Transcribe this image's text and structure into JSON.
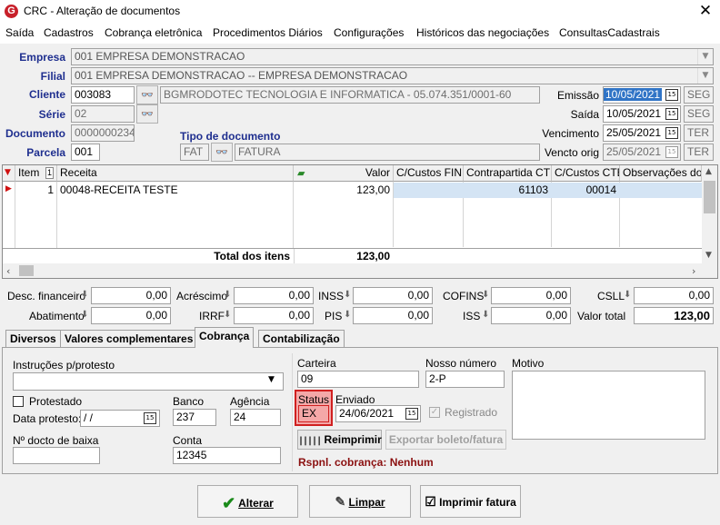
{
  "window": {
    "title": "CRC - Alteração de documentos",
    "app_icon": "G",
    "close": "✕"
  },
  "menu": [
    "Saída",
    "Cadastros",
    "Cobrança eletrônica",
    "Procedimentos Diários",
    "Configurações",
    "Históricos das negociações",
    "ConsultasCadastrais"
  ],
  "header": {
    "empresa_label": "Empresa",
    "empresa_value": "001 EMPRESA DEMONSTRACAO",
    "filial_label": "Filial",
    "filial_value": "001 EMPRESA DEMONSTRACAO -- EMPRESA DEMONSTRACAO",
    "cliente_label": "Cliente",
    "cliente_code": "003083",
    "cliente_name": "BGMRODOTEC TECNOLOGIA  E INFORMATICA - 05.074.351/0001-60",
    "serie_label": "Série",
    "serie_value": "02",
    "documento_label": "Documento",
    "documento_value": "0000000234",
    "parcela_label": "Parcela",
    "parcela_value": "001",
    "tipo_doc_label": "Tipo de documento",
    "tipo_doc_code": "FAT",
    "tipo_doc_name": "FATURA",
    "emissao_label": "Emissão",
    "emissao_value": "10/05/2021",
    "emissao_day": "SEG",
    "saida_label": "Saída",
    "saida_value": "10/05/2021",
    "saida_day": "SEG",
    "vencimento_label": "Vencimento",
    "vencimento_value": "25/05/2021",
    "vencimento_day": "TER",
    "vencto_orig_label": "Vencto orig",
    "vencto_orig_value": "25/05/2021",
    "vencto_orig_day": "TER"
  },
  "items_grid": {
    "columns": [
      "Item",
      "1",
      "Receita",
      "Valor",
      "C/Custos FIN",
      "Contrapartida CTB",
      "C/Custos CTB",
      "Observações do ite"
    ],
    "rows": [
      {
        "item": "1",
        "receita": "00048-RECEITA TESTE",
        "valor": "123,00",
        "cc_fin": "",
        "contrapartida": "61103",
        "cc_ctb": "00014",
        "obs": ""
      }
    ],
    "total_label": "Total dos itens",
    "total_value": "123,00"
  },
  "totals": {
    "desc_financeiro_label": "Desc. financeiro",
    "desc_financeiro": "0,00",
    "acrescimo_label": "Acréscimo",
    "acrescimo": "0,00",
    "inss_label": "INSS",
    "inss": "0,00",
    "cofins_label": "COFINS",
    "cofins": "0,00",
    "csll_label": "CSLL",
    "csll": "0,00",
    "abatimento_label": "Abatimento",
    "abatimento": "0,00",
    "irrf_label": "IRRF",
    "irrf": "0,00",
    "pis_label": "PIS",
    "pis": "0,00",
    "iss_label": "ISS",
    "iss": "0,00",
    "valor_total_label": "Valor total",
    "valor_total": "123,00"
  },
  "tabs": [
    "Diversos",
    "Valores complementares",
    "Cobrança",
    "Contabilização"
  ],
  "cobranca": {
    "instrucoes_label": "Instruções p/protesto",
    "instrucoes_value": "",
    "protestado_label": "Protestado",
    "data_protesto_label": "Data protesto:",
    "data_protesto_value": " /  /",
    "banco_label": "Banco",
    "banco_value": "237",
    "agencia_label": "Agência",
    "agencia_value": "24",
    "doc_baixa_label": "Nº docto de baixa",
    "doc_baixa_value": "",
    "conta_label": "Conta",
    "conta_value": "12345",
    "carteira_label": "Carteira",
    "carteira_value": "09",
    "nosso_numero_label": "Nosso número",
    "nosso_numero_value": "2-P",
    "motivo_label": "Motivo",
    "status_label": "Status",
    "status_value": "EX",
    "enviado_label": "Enviado",
    "enviado_value": "24/06/2021",
    "registrado_label": "Registrado",
    "reimprimir_label": "Reimprimir",
    "exportar_label": "Exportar boleto/fatura",
    "responsavel_label": "Rspnl. cobrança: Nenhum"
  },
  "buttons": {
    "alterar": "Alterar",
    "limpar": "Limpar",
    "imprimir": "Imprimir fatura"
  },
  "colors": {
    "accent_label": "#1f2f8f",
    "selection": "#3074c6",
    "status_highlight": "#f4a8a8",
    "status_border": "#d02020",
    "responsavel": "#8b1010"
  }
}
